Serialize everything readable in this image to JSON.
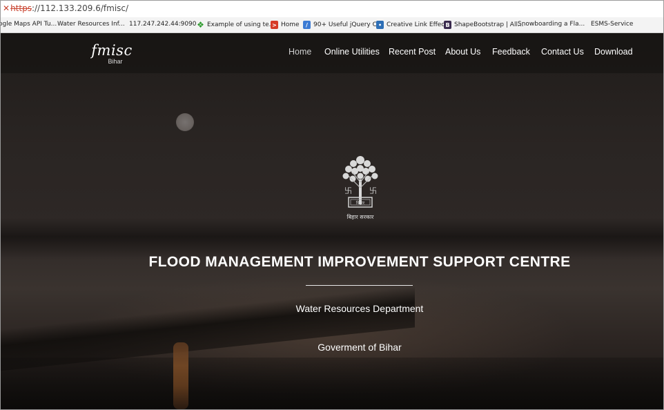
{
  "browser": {
    "address": {
      "scheme": "https",
      "rest": "://112.133.209.6/fmisc/"
    },
    "bookmarks": [
      {
        "label": "ogle Maps API Tu...",
        "icon": "page-icon"
      },
      {
        "label": "Water Resources Inf...",
        "icon": "page-icon"
      },
      {
        "label": "117.247.242.44:9090",
        "icon": "page-icon"
      },
      {
        "label": "Example of using te...",
        "icon": "green-arrows-icon"
      },
      {
        "label": "Home",
        "icon": "red-logo-icon"
      },
      {
        "label": "90+ Useful jQuery C...",
        "icon": "blue-feather-icon"
      },
      {
        "label": "Creative Link Effects",
        "icon": "blue-drop-icon"
      },
      {
        "label": "ShapeBootstrap | All...",
        "icon": "b-logo-icon"
      },
      {
        "label": "Snowboarding a Fla...",
        "icon": "page-icon"
      },
      {
        "label": "ESMS-Service",
        "icon": "page-icon"
      }
    ]
  },
  "site": {
    "brand": {
      "logo": "fmisc",
      "sub": "Bihar"
    },
    "nav": [
      "Home",
      "Online Utilities",
      "Recent Post",
      "About Us",
      "Feedback",
      "Contact Us",
      "Download"
    ],
    "emblem_caption": "बिहार सरकार",
    "emblem_inscription": "बिहार",
    "title": "FLOOD MANAGEMENT IMPROVEMENT SUPPORT CENTRE",
    "department": "Water Resources Department",
    "government": "Goverment of Bihar"
  }
}
